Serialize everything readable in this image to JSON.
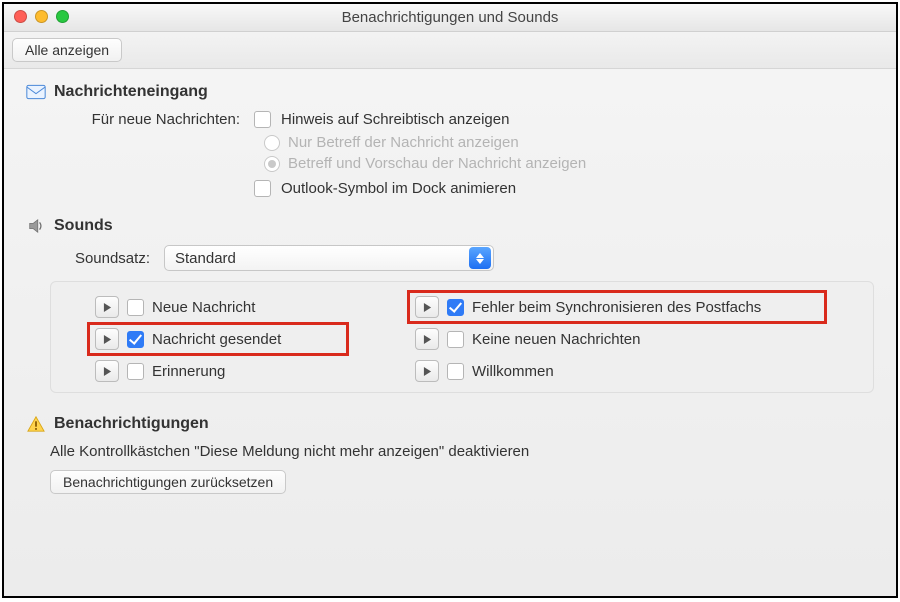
{
  "window": {
    "title": "Benachrichtigungen und Sounds"
  },
  "toolbar": {
    "show_all": "Alle anzeigen"
  },
  "section_incoming": {
    "title": "Nachrichteneingang",
    "for_new_label": "Für neue Nachrichten:",
    "show_desktop_notice": "Hinweis auf Schreibtisch anzeigen",
    "radio_subject_only": "Nur Betreff der Nachricht anzeigen",
    "radio_subject_preview": "Betreff und Vorschau der Nachricht anzeigen",
    "animate_dock": "Outlook-Symbol im Dock animieren"
  },
  "section_sounds": {
    "title": "Sounds",
    "soundset_label": "Soundsatz:",
    "soundset_value": "Standard",
    "items": [
      {
        "label": "Neue Nachricht",
        "checked": false,
        "highlight": false
      },
      {
        "label": "Fehler beim Synchronisieren des Postfachs",
        "checked": true,
        "highlight": true
      },
      {
        "label": "Nachricht gesendet",
        "checked": true,
        "highlight": true
      },
      {
        "label": "Keine neuen Nachrichten",
        "checked": false,
        "highlight": false
      },
      {
        "label": "Erinnerung",
        "checked": false,
        "highlight": false
      },
      {
        "label": "Willkommen",
        "checked": false,
        "highlight": false
      }
    ]
  },
  "section_notifications": {
    "title": "Benachrichtigungen",
    "text": "Alle Kontrollkästchen \"Diese Meldung nicht mehr anzeigen\" deaktivieren",
    "reset_button": "Benachrichtigungen zurücksetzen"
  }
}
